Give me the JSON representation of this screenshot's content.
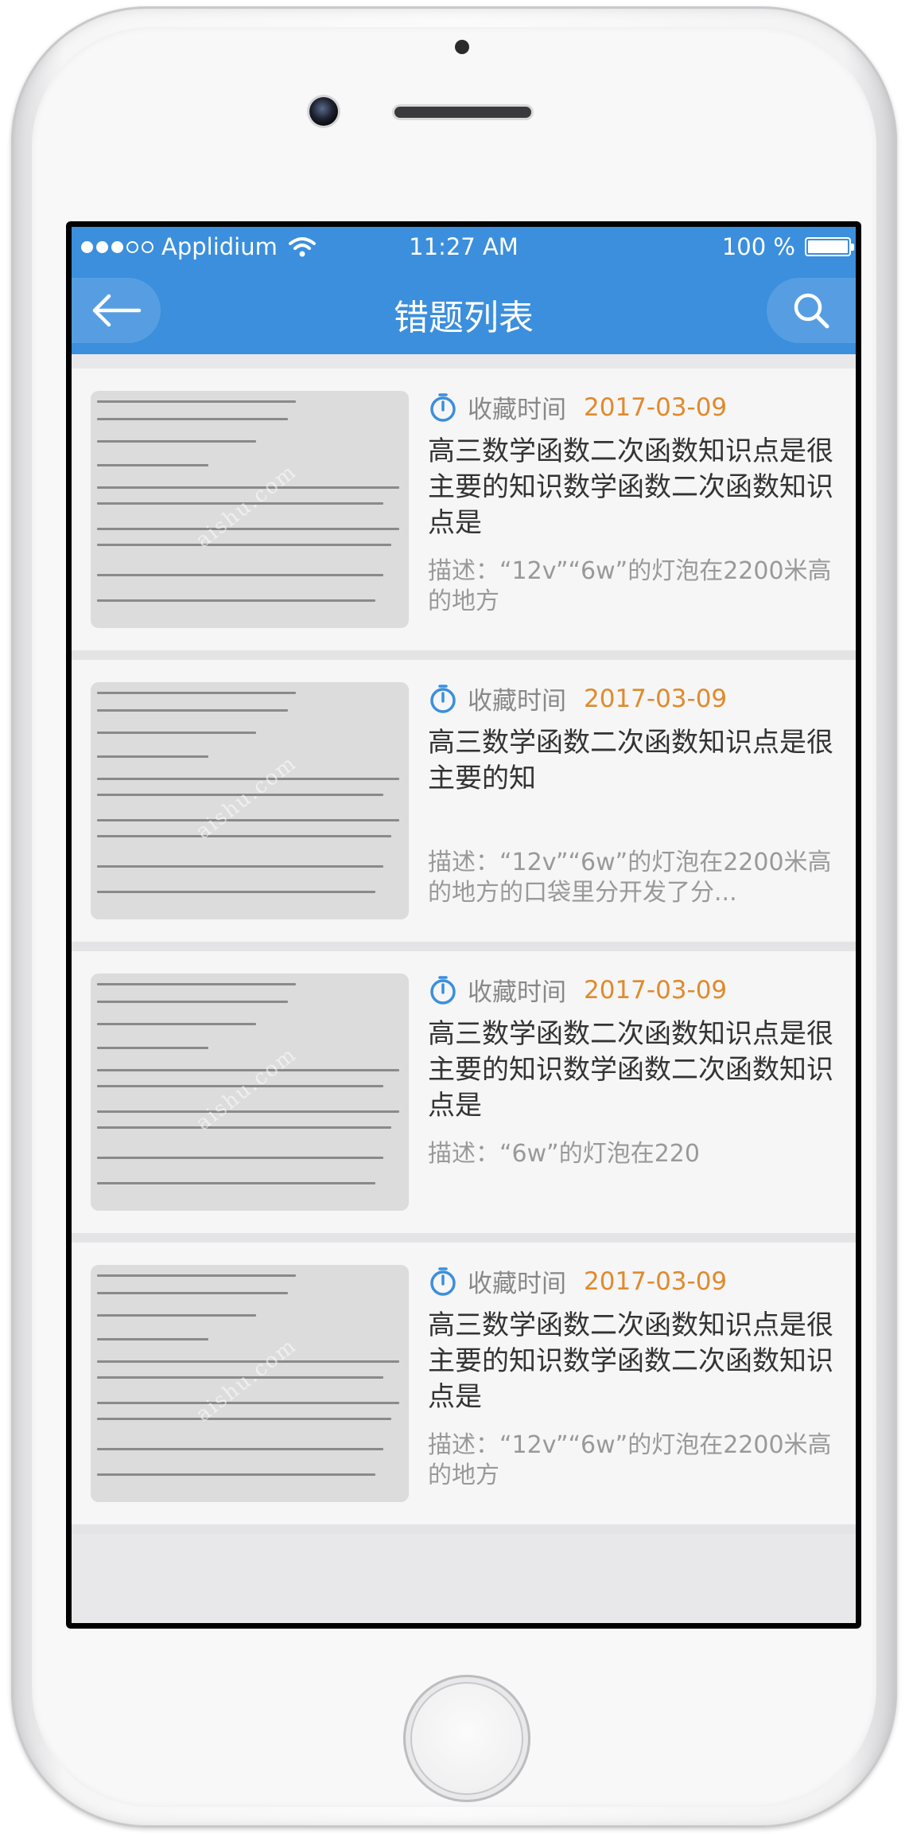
{
  "statusbar": {
    "carrier": "Applidium",
    "time": "11:27 AM",
    "battery": "100 %"
  },
  "navbar": {
    "title": "错题列表",
    "back_icon": "arrow-left-icon",
    "search_icon": "search-icon"
  },
  "colors": {
    "accent": "#3b8fdc",
    "date": "#e08a2c",
    "background": "#e8e8ea"
  },
  "list": {
    "items": [
      {
        "saved_label": "收藏时间",
        "date": "2017-03-09",
        "title": "高三数学函数二次函数知识点是很主要的知识数学函数二次函数知识点是",
        "description": "描述：“12v”“6w”的灯泡在2200米高的地方"
      },
      {
        "saved_label": "收藏时间",
        "date": "2017-03-09",
        "title": "高三数学函数二次函数知识点是很主要的知",
        "description": "描述：“12v”“6w”的灯泡在2200米高的地方的口袋里分开发了分..."
      },
      {
        "saved_label": "收藏时间",
        "date": "2017-03-09",
        "title": "高三数学函数二次函数知识点是很主要的知识数学函数二次函数知识点是",
        "description": "描述：“6w”的灯泡在220"
      },
      {
        "saved_label": "收藏时间",
        "date": "2017-03-09",
        "title": "高三数学函数二次函数知识点是很主要的知识数学函数二次函数知识点是",
        "description": "描述：“12v”“6w”的灯泡在2200米高的地方"
      }
    ]
  }
}
